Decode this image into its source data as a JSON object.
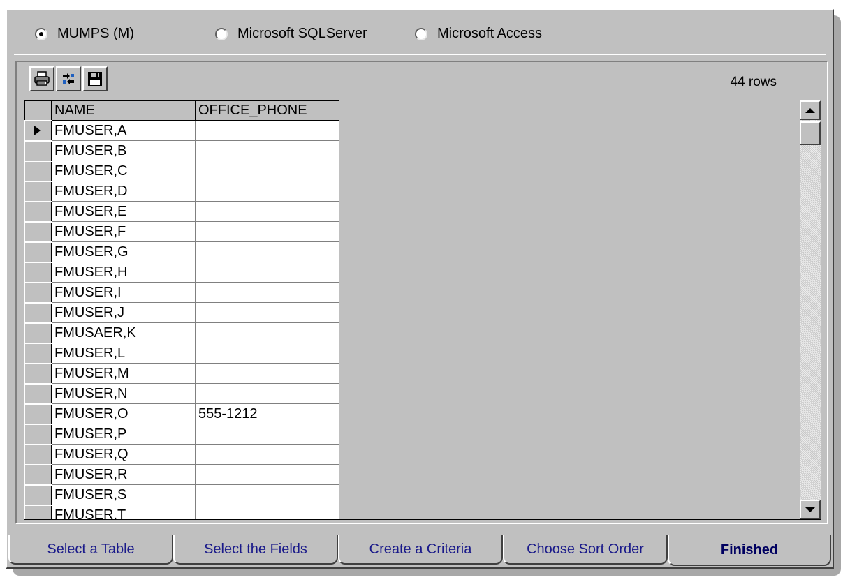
{
  "datasource": {
    "options": [
      {
        "label": "MUMPS (M)",
        "checked": true
      },
      {
        "label": "Microsoft SQLServer",
        "checked": false
      },
      {
        "label": "Microsoft Access",
        "checked": false
      }
    ]
  },
  "toolbar": {
    "buttons": [
      "printer-icon",
      "fields-icon",
      "floppy-disk-icon"
    ],
    "row_count": "44 rows"
  },
  "grid": {
    "columns": [
      "NAME",
      "OFFICE_PHONE"
    ],
    "current_row": 0,
    "rows": [
      [
        "FMUSER,A",
        ""
      ],
      [
        "FMUSER,B",
        ""
      ],
      [
        "FMUSER,C",
        ""
      ],
      [
        "FMUSER,D",
        ""
      ],
      [
        "FMUSER,E",
        ""
      ],
      [
        "FMUSER,F",
        ""
      ],
      [
        "FMUSER,G",
        ""
      ],
      [
        "FMUSER,H",
        ""
      ],
      [
        "FMUSER,I",
        ""
      ],
      [
        "FMUSER,J",
        ""
      ],
      [
        "FMUSAER,K",
        ""
      ],
      [
        "FMUSER,L",
        ""
      ],
      [
        "FMUSER,M",
        ""
      ],
      [
        "FMUSER,N",
        ""
      ],
      [
        "FMUSER,O",
        "555-1212"
      ],
      [
        "FMUSER,P",
        ""
      ],
      [
        "FMUSER,Q",
        ""
      ],
      [
        "FMUSER,R",
        ""
      ],
      [
        "FMUSER,S",
        ""
      ],
      [
        "FMUSER,T",
        ""
      ]
    ]
  },
  "tabs": [
    {
      "label": "Select a Table",
      "active": false
    },
    {
      "label": "Select the Fields",
      "active": false
    },
    {
      "label": "Create a Criteria",
      "active": false
    },
    {
      "label": "Choose Sort Order",
      "active": false
    },
    {
      "label": "Finished",
      "active": true
    }
  ]
}
